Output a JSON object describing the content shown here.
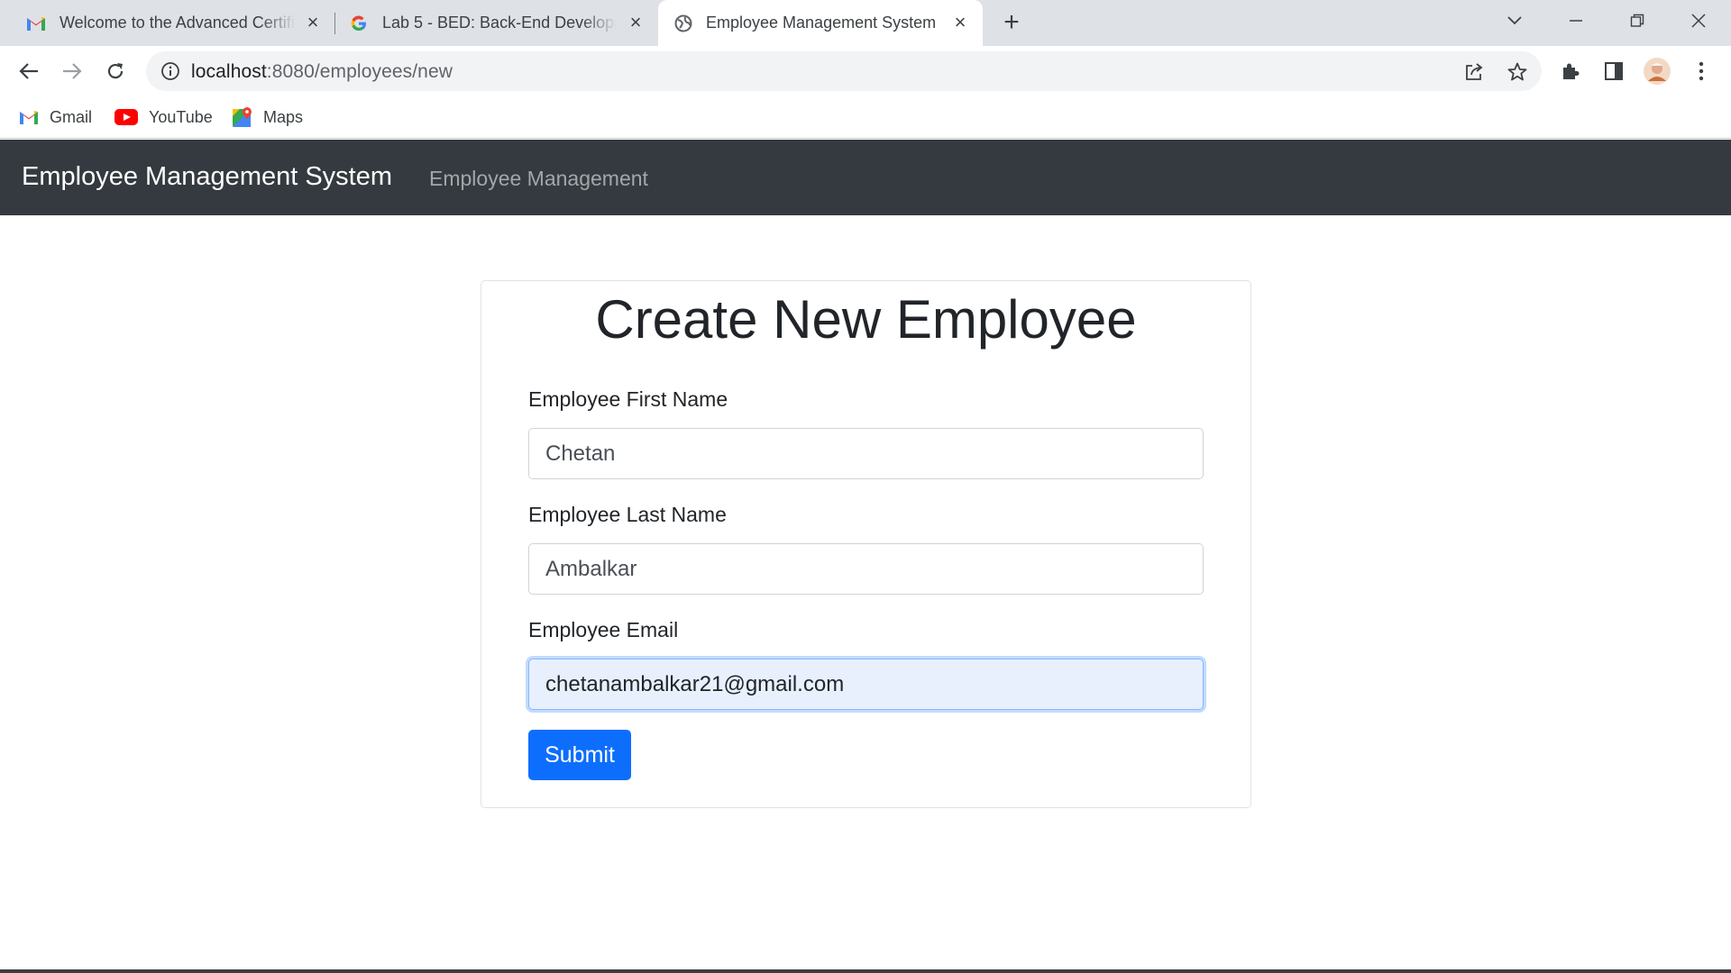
{
  "browser": {
    "tabs": [
      {
        "title": "Welcome to the Advanced Certification",
        "icon": "gmail-icon",
        "active": false
      },
      {
        "title": "Lab 5 - BED: Back-End Development",
        "icon": "google-icon",
        "active": false
      },
      {
        "title": "Employee Management System",
        "icon": "globe-icon",
        "active": true
      }
    ],
    "url_host": "localhost",
    "url_path": ":8080/employees/new",
    "bookmarks": [
      {
        "label": "Gmail",
        "icon": "gmail-icon"
      },
      {
        "label": "YouTube",
        "icon": "youtube-icon"
      },
      {
        "label": "Maps",
        "icon": "maps-icon"
      }
    ]
  },
  "navbar": {
    "brand": "Employee Management System",
    "link": "Employee Management",
    "background": "#343a40"
  },
  "form": {
    "title": "Create New Employee",
    "first_name_label": "Employee First Name",
    "first_name_value": "Chetan",
    "last_name_label": "Employee Last Name",
    "last_name_value": "Ambalkar",
    "email_label": "Employee Email",
    "email_value": "chetanambalkar21@gmail.com",
    "submit_label": "Submit",
    "submit_color": "#0d6efd"
  }
}
